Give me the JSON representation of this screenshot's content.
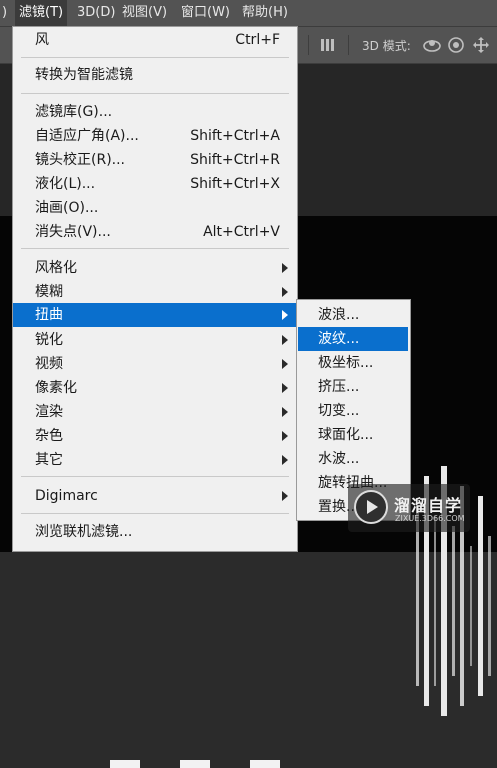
{
  "menubar": {
    "items": [
      {
        "label": ")"
      },
      {
        "label": "滤镜(T)"
      },
      {
        "label": "3D(D)"
      },
      {
        "label": "视图(V)"
      },
      {
        "label": "窗口(W)"
      },
      {
        "label": "帮助(H)"
      }
    ]
  },
  "options_bar": {
    "mode_label": "3D 模式:",
    "icons": [
      "align-distribute-icon",
      "3d-orbit-icon",
      "3d-roll-icon",
      "3d-pan-icon"
    ]
  },
  "filter_menu": {
    "items": [
      {
        "label": "风",
        "shortcut": "Ctrl+F"
      },
      {
        "label": "转换为智能滤镜"
      },
      {
        "label": "滤镜库(G)..."
      },
      {
        "label": "自适应广角(A)...",
        "shortcut": "Shift+Ctrl+A"
      },
      {
        "label": "镜头校正(R)...",
        "shortcut": "Shift+Ctrl+R"
      },
      {
        "label": "液化(L)...",
        "shortcut": "Shift+Ctrl+X"
      },
      {
        "label": "油画(O)..."
      },
      {
        "label": "消失点(V)...",
        "shortcut": "Alt+Ctrl+V"
      },
      {
        "label": "风格化"
      },
      {
        "label": "模糊"
      },
      {
        "label": "扭曲"
      },
      {
        "label": "锐化"
      },
      {
        "label": "视频"
      },
      {
        "label": "像素化"
      },
      {
        "label": "渲染"
      },
      {
        "label": "杂色"
      },
      {
        "label": "其它"
      },
      {
        "label": "Digimarc"
      },
      {
        "label": "浏览联机滤镜..."
      }
    ]
  },
  "distort_submenu": {
    "items": [
      {
        "label": "波浪..."
      },
      {
        "label": "波纹..."
      },
      {
        "label": "极坐标..."
      },
      {
        "label": "挤压..."
      },
      {
        "label": "切变..."
      },
      {
        "label": "球面化..."
      },
      {
        "label": "水波..."
      },
      {
        "label": "旋转扭曲..."
      },
      {
        "label": "置换..."
      }
    ]
  },
  "watermark": {
    "name": "溜溜自学",
    "url": "ZIXUE.3D66.COM"
  },
  "colors": {
    "highlight": "#0a6fcd",
    "menu_bg": "#f0f0f0",
    "ui_bar": "#535353"
  }
}
